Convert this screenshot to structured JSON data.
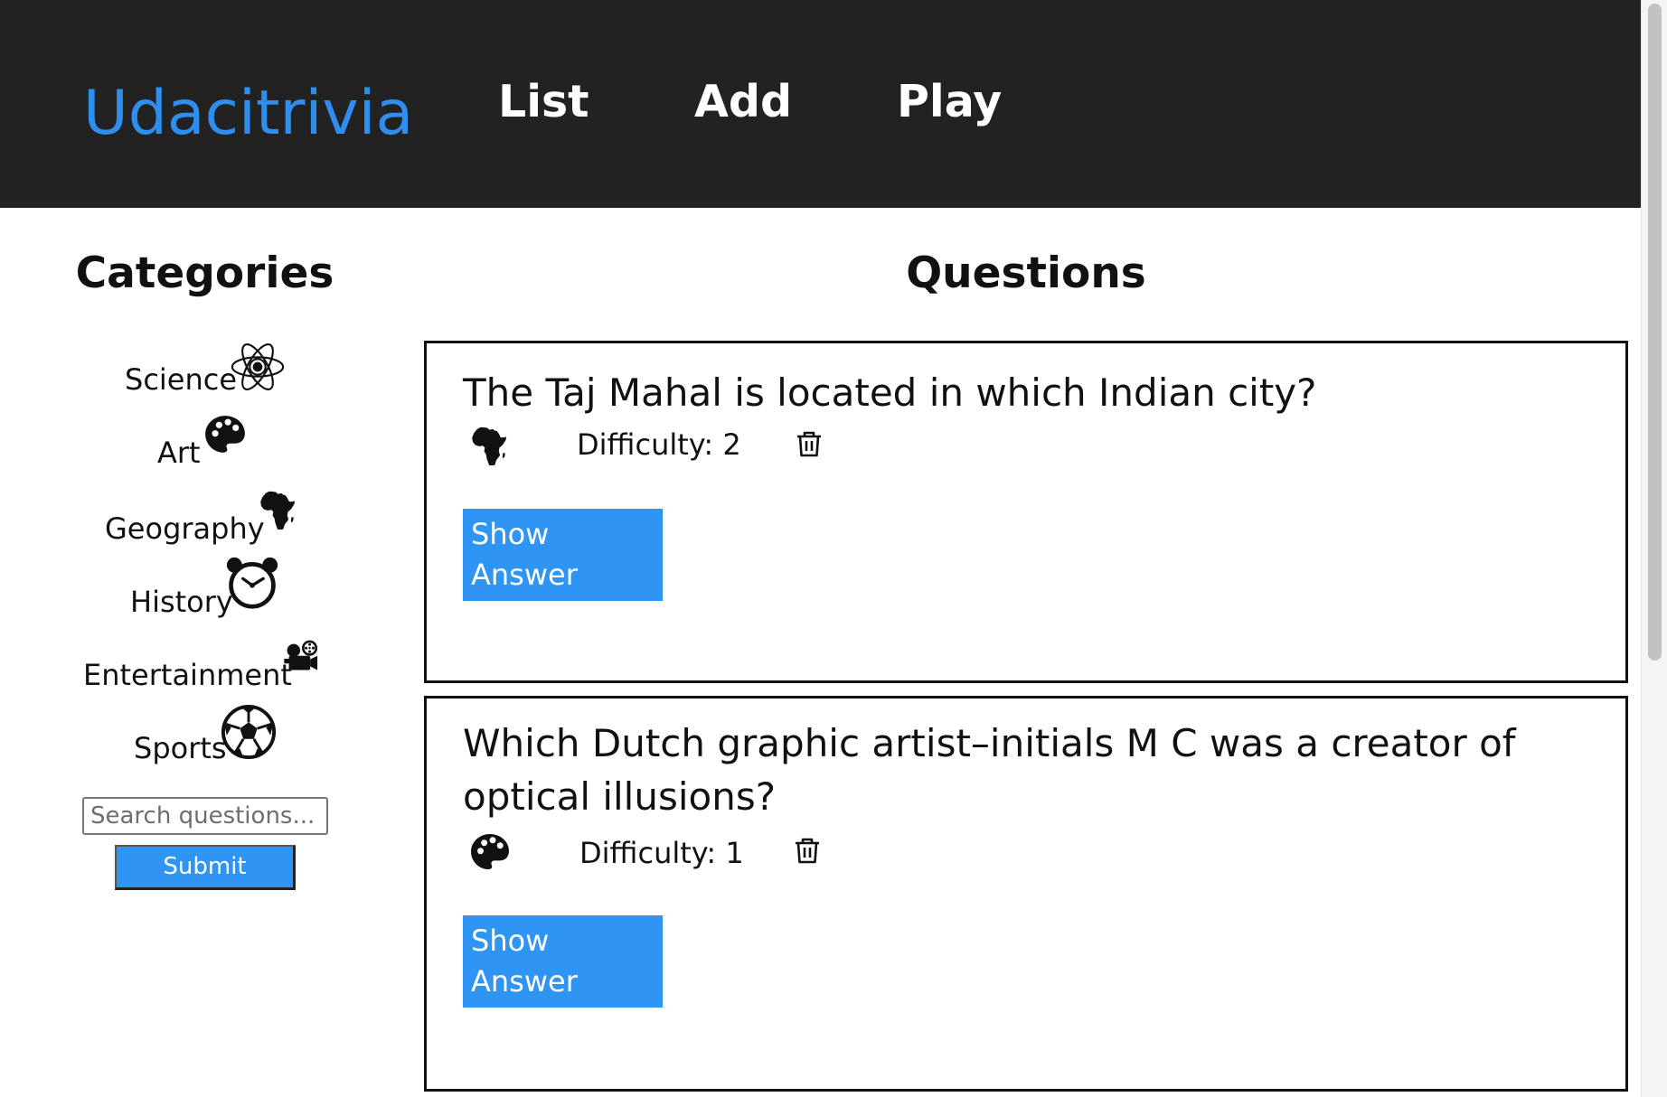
{
  "colors": {
    "navbar_bg": "#222222",
    "brand": "#2f8fee",
    "button_blue": "#2f95f4",
    "text": "#111111"
  },
  "header": {
    "brand": "Udacitrivia",
    "nav": [
      {
        "label": "List"
      },
      {
        "label": "Add"
      },
      {
        "label": "Play"
      }
    ]
  },
  "sidebar": {
    "title": "Categories",
    "categories": [
      {
        "label": "Science",
        "icon": "atom-icon"
      },
      {
        "label": "Art",
        "icon": "palette-icon"
      },
      {
        "label": "Geography",
        "icon": "africa-icon"
      },
      {
        "label": "History",
        "icon": "alarm-clock-icon"
      },
      {
        "label": "Entertainment",
        "icon": "film-projector-icon"
      },
      {
        "label": "Sports",
        "icon": "soccer-ball-icon"
      }
    ],
    "search": {
      "placeholder": "Search questions...",
      "value": ""
    },
    "submit_label": "Submit"
  },
  "main": {
    "title": "Questions",
    "questions": [
      {
        "text": "The Taj Mahal is located in which Indian city?",
        "category_icon": "africa-icon",
        "difficulty": "Difficulty: 2",
        "show_answer_label": "Show Answer"
      },
      {
        "text": "Which Dutch graphic artist–initials M C was a creator of optical illusions?",
        "category_icon": "palette-icon",
        "difficulty": "Difficulty: 1",
        "show_answer_label": "Show Answer"
      }
    ]
  }
}
